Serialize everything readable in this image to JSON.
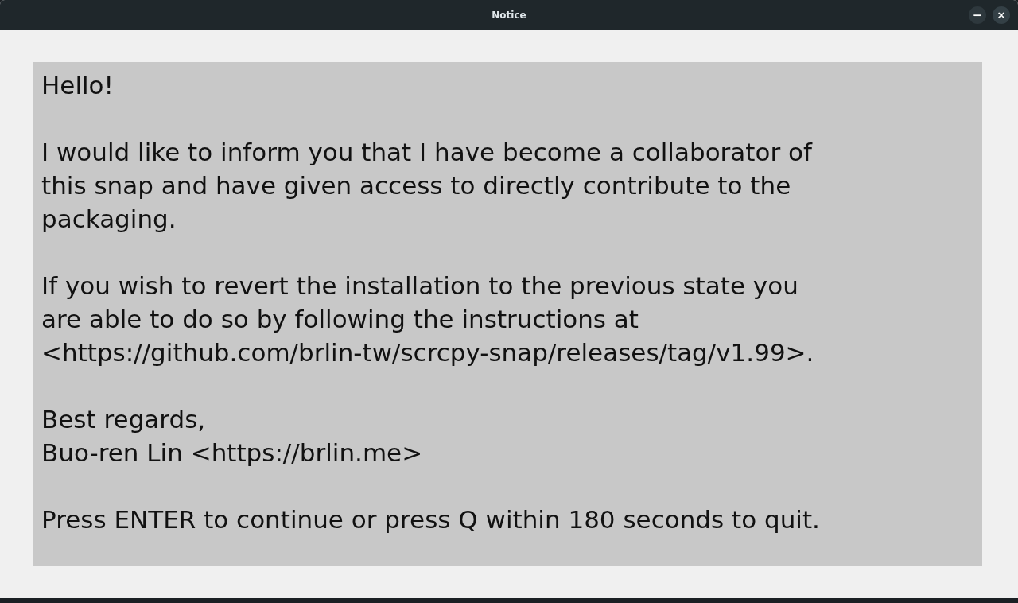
{
  "window": {
    "title": "Notice",
    "buttons": [
      {
        "kind": "minimize",
        "label": "−"
      },
      {
        "kind": "close",
        "label": "×"
      }
    ]
  },
  "message": {
    "paragraphs": [
      "Hello!",
      "I would like to inform you that I have become a collaborator of\nthis snap and have given access to directly contribute to the\npackaging.",
      "If you wish to revert the installation to the previous state you\nare able to do so by following the instructions at\n<https://github.com/brlin-tw/scrcpy-snap/releases/tag/v1.99>.",
      "Best regards,\nBuo-ren Lin <https://brlin.me>",
      "Press ENTER to continue or press Q within 180 seconds to quit."
    ]
  }
}
